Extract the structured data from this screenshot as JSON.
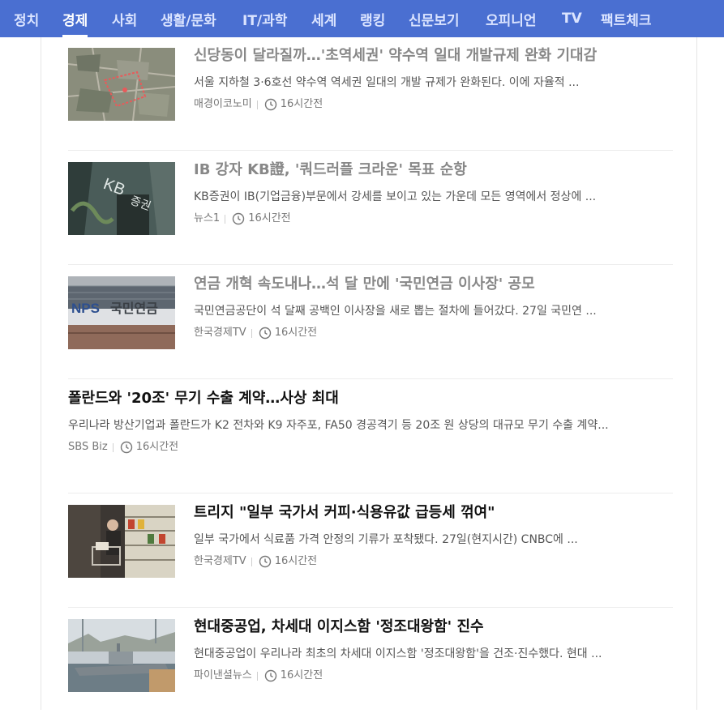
{
  "nav": {
    "tabs": [
      {
        "label": "정치",
        "active": false
      },
      {
        "label": "경제",
        "active": true
      },
      {
        "label": "사회",
        "active": false
      },
      {
        "label": "생활/문화",
        "active": false
      },
      {
        "label": "IT/과학",
        "active": false
      },
      {
        "label": "세계",
        "active": false
      },
      {
        "label": "랭킹",
        "active": false
      },
      {
        "label": "신문보기",
        "active": false
      },
      {
        "label": "오피니언",
        "active": false
      },
      {
        "label": "TV",
        "active": false
      },
      {
        "label": "팩트체크",
        "active": false
      }
    ]
  },
  "articles": [
    {
      "title": "신당동이 달라질까…'초역세권' 약수역 일대 개발규제 완화 기대감",
      "summary": "서울 지하철 3·6호선 약수역 역세권 일대의 개발 규제가 완화된다. 이에 자율적 ...",
      "source": "매경이코노미",
      "time": "16시간전",
      "thumbnail": "aerial-map-image"
    },
    {
      "title": "IB 강자 KB證, '쿼드러플 크라운' 목표 순항",
      "summary": "KB증권이 IB(기업금융)부문에서 강세를 보이고 있는 가운데 모든 영역에서 정상에 ...",
      "source": "뉴스1",
      "time": "16시간전",
      "thumbnail": "kb-securities-sign-image"
    },
    {
      "title": "연금 개혁 속도내나…석 달 만에 '국민연금 이사장' 공모",
      "summary": "국민연금공단이 석 달째 공백인 이사장을 새로 뽑는 절차에 들어갔다. 27일 국민연 ...",
      "source": "한국경제TV",
      "time": "16시간전",
      "thumbnail": "nps-building-image"
    },
    {
      "title": "폴란드와 '20조' 무기 수출 계약…사상 최대",
      "summary": "우리나라 방산기업과 폴란드가 K2 전차와 K9 자주포, FA50 경공격기 등 20조 원 상당의 대규모 무기 수출 계약...",
      "source": "SBS Biz",
      "time": "16시간전",
      "thumbnail": ""
    },
    {
      "title": "트리지 \"일부 국가서 커피·식용유값 급등세 꺾여\"",
      "summary": "일부 국가에서 식료품 가격 안정의 기류가 포착됐다. 27일(현지시간) CNBC에 ...",
      "source": "한국경제TV",
      "time": "16시간전",
      "thumbnail": "supermarket-shopper-image"
    },
    {
      "title": "현대중공업, 차세대 이지스함 '정조대왕함' 진수",
      "summary": "현대중공업이 우리나라 최초의 차세대 이지스함 '정조대왕함'을 건조·진수했다. 현대 ...",
      "source": "파이낸셜뉴스",
      "time": "16시간전",
      "thumbnail": "warship-launch-image"
    }
  ],
  "colors": {
    "nav_background": "#4a6fd1",
    "nav_text": "#dbe4ff",
    "visited_headline": "#888888",
    "unvisited_headline": "#111111"
  }
}
